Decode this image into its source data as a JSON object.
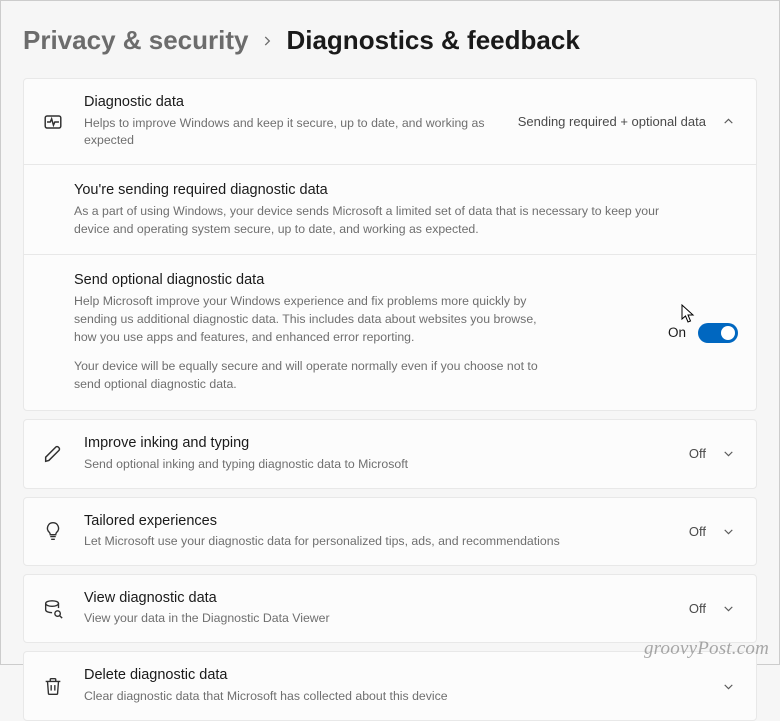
{
  "breadcrumb": {
    "parent": "Privacy & security",
    "current": "Diagnostics & feedback"
  },
  "diag": {
    "title": "Diagnostic data",
    "desc": "Helps to improve Windows and keep it secure, up to date, and working as expected",
    "status": "Sending required + optional data"
  },
  "required": {
    "title": "You're sending required diagnostic data",
    "desc": "As a part of using Windows, your device sends Microsoft a limited set of data that is necessary to keep your device and operating system secure, up to date, and working as expected."
  },
  "optional": {
    "title": "Send optional diagnostic data",
    "desc1": "Help Microsoft improve your Windows experience and fix problems more quickly by sending us additional diagnostic data. This includes data about websites you browse, how you use apps and features, and enhanced error reporting.",
    "desc2": "Your device will be equally secure and will operate normally even if you choose not to send optional diagnostic data.",
    "toggle_label": "On"
  },
  "inking": {
    "title": "Improve inking and typing",
    "desc": "Send optional inking and typing diagnostic data to Microsoft",
    "status": "Off"
  },
  "tailored": {
    "title": "Tailored experiences",
    "desc": "Let Microsoft use your diagnostic data for personalized tips, ads, and recommendations",
    "status": "Off"
  },
  "view": {
    "title": "View diagnostic data",
    "desc": "View your data in the Diagnostic Data Viewer",
    "status": "Off"
  },
  "delete": {
    "title": "Delete diagnostic data",
    "desc": "Clear diagnostic data that Microsoft has collected about this device"
  },
  "watermark": "groovyPost.com"
}
